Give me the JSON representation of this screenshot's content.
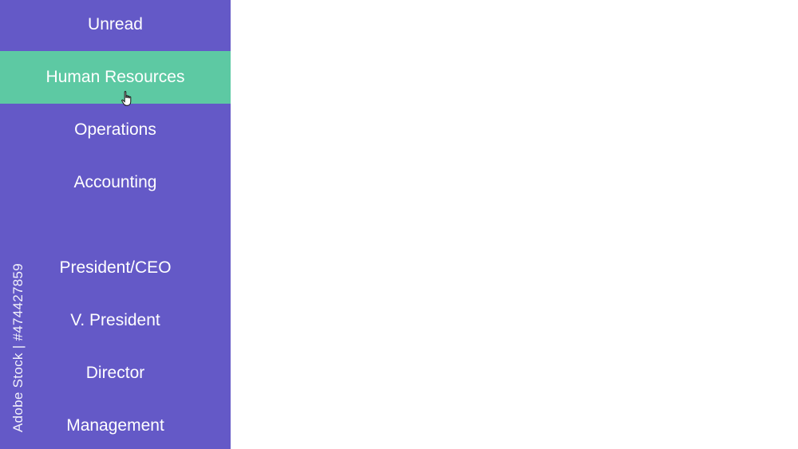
{
  "sidebar": {
    "items": [
      {
        "label": "Unread"
      },
      {
        "label": "Human Resources"
      },
      {
        "label": "Operations"
      },
      {
        "label": "Accounting"
      },
      {
        "label": "President/CEO"
      },
      {
        "label": "V. President"
      },
      {
        "label": "Director"
      },
      {
        "label": "Management"
      }
    ],
    "active_item": "Human Resources",
    "background_color": "#6459c7",
    "active_color": "#5dc9a3"
  },
  "watermark": {
    "side_text": "Adobe Stock | #474427859"
  },
  "cursor": {
    "icon": "hand-pointer-icon"
  }
}
